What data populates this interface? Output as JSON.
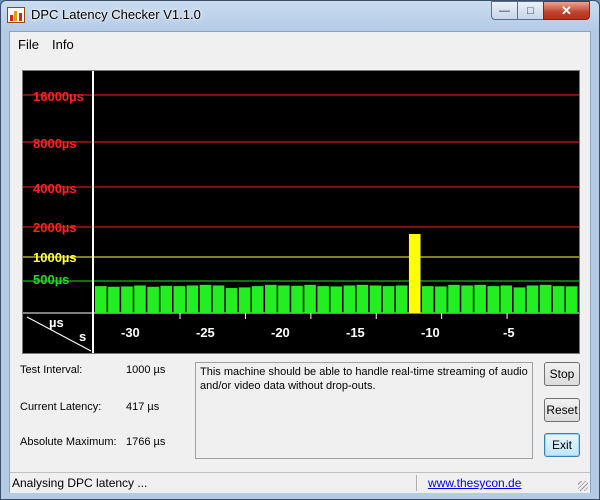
{
  "window": {
    "title": "DPC Latency Checker V1.1.0",
    "controls": {
      "minimize": "—",
      "maximize": "□",
      "close": "✕"
    }
  },
  "menu": {
    "items": [
      "File",
      "Info"
    ]
  },
  "graph": {
    "y_labels": [
      {
        "text": "16000µs",
        "color": "#ff2020"
      },
      {
        "text": "8000µs",
        "color": "#ff2020"
      },
      {
        "text": "4000µs",
        "color": "#ff2020"
      },
      {
        "text": "2000µs",
        "color": "#ff2020"
      },
      {
        "text": "1000µs",
        "color": "#ffff40"
      },
      {
        "text": "500µs",
        "color": "#22dd22"
      }
    ],
    "axis_unit_top": "µs",
    "axis_unit_bottom": "s",
    "x_ticks": [
      "-30",
      "-25",
      "-20",
      "-15",
      "-10",
      "-5"
    ]
  },
  "chart_data": {
    "type": "bar",
    "x_ticks": [
      -30,
      -25,
      -20,
      -15,
      -10,
      -5
    ],
    "reference_lines_us": [
      16000,
      8000,
      4000,
      2000,
      1000,
      500
    ],
    "values": [
      420,
      410,
      415,
      430,
      410,
      425,
      420,
      430,
      440,
      430,
      390,
      400,
      420,
      440,
      430,
      425,
      440,
      420,
      415,
      430,
      440,
      430,
      420,
      430,
      1766,
      420,
      415,
      440,
      430,
      440,
      420,
      430,
      400,
      430,
      440,
      420,
      417
    ],
    "colors": {
      "normal": "#22ee22",
      "warning": "#ffff00",
      "danger": "#ff0000"
    }
  },
  "info": {
    "test_interval_label": "Test Interval:",
    "test_interval_value": "1000 µs",
    "current_latency_label": "Current Latency:",
    "current_latency_value": "417 µs",
    "absolute_max_label": "Absolute Maximum:",
    "absolute_max_value": "1766 µs",
    "message": "This machine should be able to handle real-time streaming of audio and/or video data without drop-outs."
  },
  "buttons": {
    "stop": "Stop",
    "reset": "Reset",
    "exit": "Exit"
  },
  "status": {
    "text": "Analysing DPC latency ...",
    "link": "www.thesycon.de"
  }
}
